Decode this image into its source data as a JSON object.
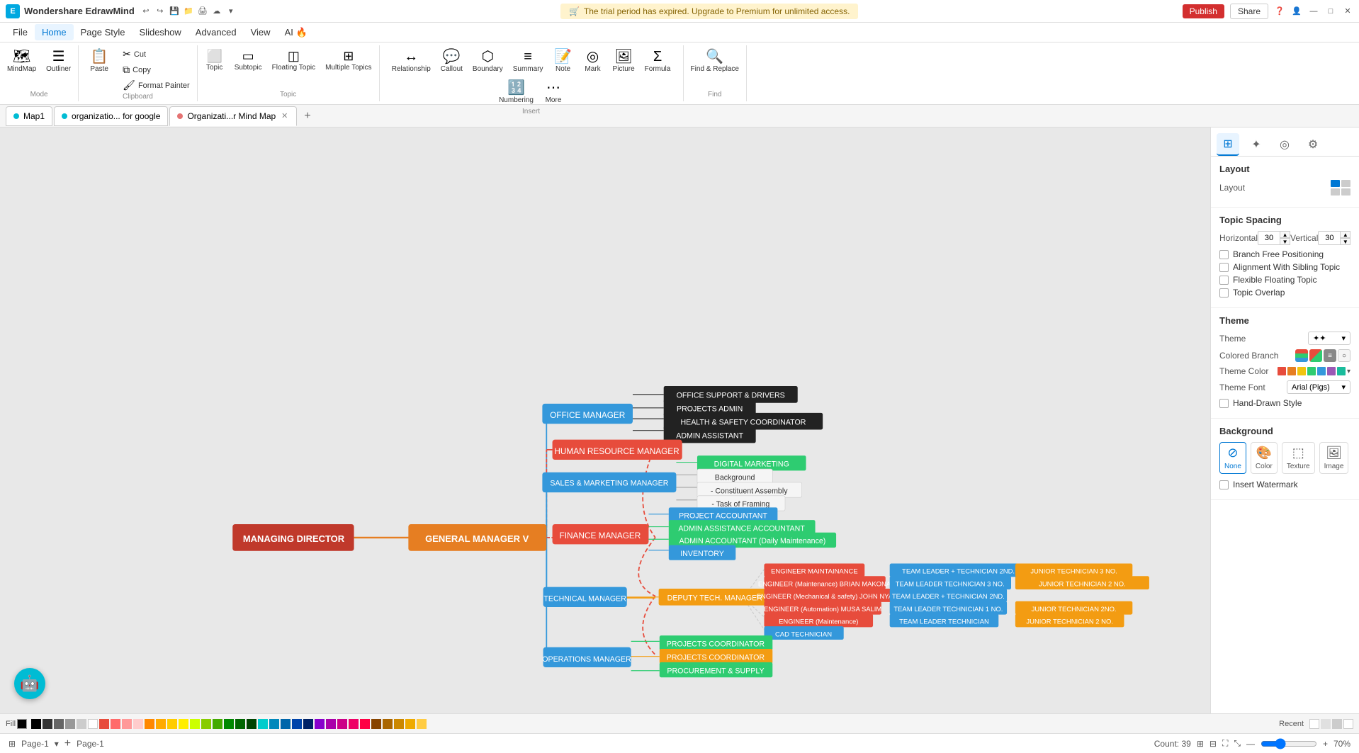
{
  "app": {
    "name": "Wondershare EdrawMind",
    "logo_char": "E"
  },
  "trial_bar": {
    "icon": "🛒",
    "text": "The trial period has expired. Upgrade to Premium for unlimited access."
  },
  "title_bar_right": {
    "publish": "Publish",
    "share": "Share"
  },
  "menu": {
    "items": [
      "File",
      "Home",
      "Page Style",
      "Slideshow",
      "Advanced",
      "View",
      "AI 🔥"
    ]
  },
  "ribbon": {
    "mode_group": {
      "label": "Mode",
      "items": [
        {
          "icon": "🗺",
          "label": "MindMap"
        },
        {
          "icon": "☰",
          "label": "Outliner"
        }
      ]
    },
    "clipboard_group": {
      "label": "Clipboard",
      "paste": "Paste",
      "cut": "Cut",
      "copy": "Copy",
      "format_painter": "Format Painter"
    },
    "topic_group": {
      "label": "Topic",
      "items": [
        {
          "icon": "⬜",
          "label": "Topic"
        },
        {
          "icon": "⬜",
          "label": "Subtopic"
        },
        {
          "icon": "⬜",
          "label": "Floating Topic"
        },
        {
          "icon": "⬜",
          "label": "Multiple Topics"
        }
      ]
    },
    "insert_group": {
      "label": "Insert",
      "items": [
        {
          "icon": "↔",
          "label": "Relationship"
        },
        {
          "icon": "○",
          "label": "Callout"
        },
        {
          "icon": "⬡",
          "label": "Boundary"
        },
        {
          "icon": "≡",
          "label": "Summary"
        },
        {
          "icon": "✏",
          "label": "Note"
        },
        {
          "icon": "◎",
          "label": "Mark"
        },
        {
          "icon": "🖼",
          "label": "Picture"
        },
        {
          "icon": "Σ",
          "label": "Formula"
        },
        {
          "icon": "≡",
          "label": "Numbering"
        },
        {
          "icon": "⋯",
          "label": "More"
        }
      ]
    },
    "find_group": {
      "label": "Find",
      "items": [
        {
          "icon": "🔍",
          "label": "Find & Replace"
        }
      ]
    }
  },
  "tabs": {
    "items": [
      {
        "label": "Map1",
        "dot_color": "#00bcd4",
        "closable": false,
        "active": false
      },
      {
        "label": "organizatio... for google",
        "dot_color": "#00bcd4",
        "closable": false,
        "active": false
      },
      {
        "label": "Organizati...r Mind Map",
        "dot_color": "#e57373",
        "closable": true,
        "active": true
      }
    ]
  },
  "right_panel": {
    "tabs": [
      {
        "icon": "⊞",
        "label": "layout",
        "active": true
      },
      {
        "icon": "✦",
        "label": "style"
      },
      {
        "icon": "◎",
        "label": "topic-info"
      },
      {
        "icon": "⚙",
        "label": "settings"
      }
    ],
    "layout": {
      "title": "Layout",
      "layout_label": "Layout",
      "topic_spacing": {
        "title": "Topic Spacing",
        "horizontal_label": "Horizontal",
        "horizontal_value": "30",
        "vertical_label": "Vertical",
        "vertical_value": "30"
      },
      "checkboxes": [
        {
          "label": "Branch Free Positioning",
          "checked": false
        },
        {
          "label": "Alignment With Sibling Topic",
          "checked": false
        },
        {
          "label": "Flexible Floating Topic",
          "checked": false
        },
        {
          "label": "Topic Overlap",
          "checked": false
        }
      ]
    },
    "theme": {
      "title": "Theme",
      "theme_label": "Theme",
      "colored_branch_label": "Colored Branch",
      "theme_color_label": "Theme Color",
      "theme_font_label": "Theme Font",
      "theme_font_value": "Arial (Pigs)",
      "hand_drawn_label": "Hand-Drawn Style"
    },
    "background": {
      "title": "Background",
      "options": [
        "None",
        "Color",
        "Texture",
        "Image"
      ],
      "active": "None",
      "insert_watermark": "Insert Watermark"
    }
  },
  "mindmap": {
    "root": {
      "label": "MANAGING DIRECTOR",
      "color": "#c0392b",
      "text_color": "#fff"
    },
    "level1_1": {
      "label": "GENERAL MANAGER V",
      "color": "#e67e22",
      "text_color": "#fff"
    },
    "branches": [
      {
        "label": "OFFICE MANAGER",
        "color": "#3498db",
        "children": [
          {
            "label": "OFFICE SUPPORT & DRIVERS",
            "color": "#333",
            "text_color": "#fff"
          },
          {
            "label": "PROJECTS ADMIN",
            "color": "#333",
            "text_color": "#fff"
          },
          {
            "label": "HEALTH & SAFETY COORDINATOR",
            "color": "#333",
            "text_color": "#fff"
          },
          {
            "label": "ADMIN ASSISTANT",
            "color": "#333",
            "text_color": "#fff"
          }
        ]
      },
      {
        "label": "HUMAN RESOURCE MANAGER",
        "color": "#e74c3c",
        "children": []
      },
      {
        "label": "SALES & MARKETING MANAGER",
        "color": "#3498db",
        "children": [
          {
            "label": "DIGITAL MARKETING",
            "color": "#2ecc71",
            "text_color": "#fff"
          },
          {
            "label": "Background",
            "color": "#fff",
            "text_color": "#333"
          },
          {
            "label": "- Constituent Assembly",
            "color": "#fff",
            "text_color": "#333"
          },
          {
            "label": "- Task of Framing",
            "color": "#fff",
            "text_color": "#333"
          }
        ]
      },
      {
        "label": "FINANCE MANAGER",
        "color": "#e74c3c",
        "children": [
          {
            "label": "PROJECT ACCOUNTANT",
            "color": "#3498db",
            "text_color": "#fff"
          },
          {
            "label": "ADMIN ASSISTANCE ACCOUNTANT",
            "color": "#2ecc71",
            "text_color": "#fff"
          },
          {
            "label": "ADMIN ACCOUNTANT (Daily Maintenance)",
            "color": "#2ecc71",
            "text_color": "#fff"
          },
          {
            "label": "INVENTORY",
            "color": "#3498db",
            "text_color": "#fff"
          }
        ]
      },
      {
        "label": "TECHNICAL MANAGER",
        "color": "#3498db",
        "children": [
          {
            "label": "DEPUTY TECH. MANAGER",
            "color": "#f39c12",
            "text_color": "#fff"
          }
        ]
      },
      {
        "label": "OPERATIONS MANAGER",
        "color": "#3498db",
        "children": [
          {
            "label": "PROJECTS COORDINATOR",
            "color": "#2ecc71",
            "text_color": "#fff"
          },
          {
            "label": "PROJECTS COORDINATOR",
            "color": "#f39c12",
            "text_color": "#fff"
          },
          {
            "label": "PROCUREMENT & SUPPLY",
            "color": "#2ecc71",
            "text_color": "#fff"
          }
        ]
      }
    ]
  },
  "status_bar": {
    "grid_icon": "⊞",
    "page_label": "Page-1",
    "add_page": "+",
    "page_indicator": "Page-1",
    "count": "Count: 39",
    "zoom": "70%"
  },
  "color_bar": {
    "fill_label": "Fill",
    "colors": [
      "#000",
      "#fff",
      "#f5f5f5",
      "#e0e0e0",
      "#c0c0c0",
      "#ff0000",
      "#ff4444",
      "#ff8888",
      "#ffaaaa",
      "#ffcccc",
      "#ff8800",
      "#ffaa00",
      "#ffcc00",
      "#ffee00",
      "#ffff44",
      "#88cc00",
      "#44aa00",
      "#008800",
      "#006600",
      "#004400",
      "#00aacc",
      "#0088bb",
      "#0066aa",
      "#004488",
      "#002266",
      "#8800cc",
      "#aa00aa",
      "#cc0088",
      "#ee0066",
      "#ff0044",
      "#884400",
      "#aa6600",
      "#cc8800",
      "#eeaa00",
      "#ffcc44"
    ]
  }
}
